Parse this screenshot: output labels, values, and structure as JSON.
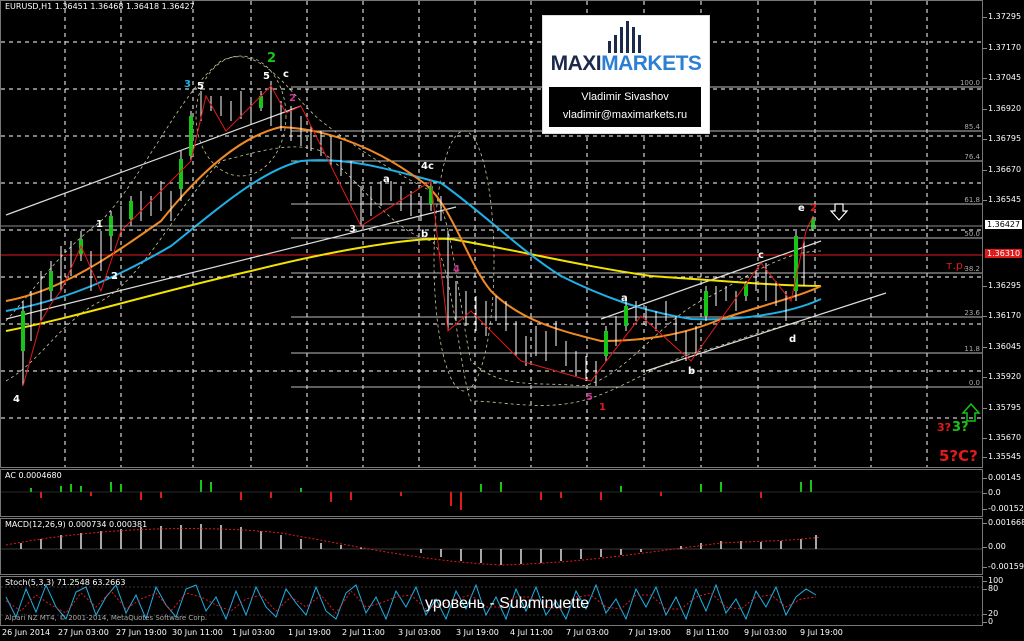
{
  "main": {
    "title": "EURUSD,H1  1.36451 1.36468 1.36418 1.36427",
    "price_axis": [
      "1.37295",
      "1.37170",
      "1.37045",
      "1.36920",
      "1.36795",
      "1.36670",
      "1.36545",
      "1.36427",
      "1.36295",
      "1.36170",
      "1.36045",
      "1.35920",
      "1.35795",
      "1.35670",
      "1.35545",
      "1.35420"
    ],
    "current_price": "1.36427",
    "red_level": "1.36310",
    "fib_levels": [
      "100.0",
      "85.4",
      "76.4",
      "61.8",
      "50.0",
      "38.2",
      "23.6",
      "11.8",
      "0.0"
    ],
    "target_label": "т.р.",
    "logo": {
      "brand_black": "MAXI",
      "brand_blue": "MARKETS",
      "name": "Vladimir Sivashov",
      "email": "vladimir@maximarkets.ru"
    },
    "wave_labels": {
      "wave2_green": "2",
      "top_5": "5",
      "top_c": "c",
      "top_2": "2",
      "left_3": "3",
      "left_4": "4",
      "left_5": "5",
      "left_1": "1",
      "left_2": "2",
      "mid_4c": "4c",
      "mid_a": "a",
      "mid_b": "b",
      "mid_3": "3",
      "mid_4": "4",
      "low_5": "5",
      "low_1": "1",
      "right_a": "a",
      "right_b": "b",
      "right_c": "c",
      "right_d": "d",
      "right_e": "e",
      "right_2": "2",
      "forecast_1": "3?",
      "forecast_2": "3?",
      "forecast_3": "5?C?"
    },
    "colors": {
      "green": "#18c418",
      "red": "#e21a1a",
      "cyan": "#1fb0e6",
      "orange": "#f08a24",
      "yellow": "#f2e300",
      "magenta": "#c8388f"
    }
  },
  "ac": {
    "label": "AC 0.0004680",
    "axis": [
      "0.00145",
      "0.0",
      "-0.00152"
    ]
  },
  "macd": {
    "label": "MACD(12,26,9) 0.000734 0.000381",
    "axis": [
      "0.001668",
      "0.00",
      "-0.001596"
    ]
  },
  "stoch": {
    "label": "Stoch(5,3,3) 71.2548 63.2663",
    "axis": [
      "100",
      "80",
      "20",
      "0"
    ],
    "footer": "Alpari NZ MT4, © 2001-2014, MetaQuotes Software Corp."
  },
  "watermark": "уровень - Subminuette",
  "time_axis": [
    "26 Jun 2014",
    "27 Jun 03:00",
    "27 Jun 19:00",
    "30 Jun 11:00",
    "1 Jul 03:00",
    "1 Jul 19:00",
    "2 Jul 11:00",
    "3 Jul 03:00",
    "3 Jul 19:00",
    "4 Jul 11:00",
    "7 Jul 03:00",
    "7 Jul 19:00",
    "8 Jul 11:00",
    "9 Jul 03:00",
    "9 Jul 19:00"
  ]
}
